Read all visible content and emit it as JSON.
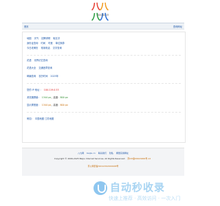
{
  "brand": {
    "mark": [
      "八",
      "八",
      "八",
      "八"
    ],
    "domain": "baijiu.cn"
  },
  "topbar": {
    "home": "首页",
    "setup": "查询网址"
  },
  "lines": {
    "l1": [
      "地图",
      "天气",
      "招聘求职",
      "取名字"
    ],
    "l2": [
      "身份证查询",
      "时间",
      "时差",
      "单位换算"
    ],
    "l3": [
      "今日老黄历",
      "常用电话",
      "汉字查询"
    ],
    "l4": [
      "花语",
      "世界记忆查询"
    ],
    "l5": [
      "花语大全",
      "交通违章查询"
    ],
    "l6": [
      "邮编查询",
      "农历时间",
      "2025年"
    ],
    "ip_label": "您的 IP 地址 ：",
    "ip_value": "100.119.0.53",
    "res_label": "浏览器屏幕：",
    "res_w": "1344 px",
    "res_sep": "，高度：",
    "res_h": "800 px",
    "view_label": "显示屏宽度：",
    "view_w": "1344 px",
    "view_sep": "，高度：",
    "view_h": "800 px",
    "loc_label": "例如：",
    "loc_value": "中国地图 江苏地图"
  },
  "footer": {
    "row1": [
      "八九网",
      "baijiu.cn",
      "联系我们",
      "隐私",
      "哪里实用网址"
    ],
    "copyright": "Copyright © 2006-2025 Baijiu Internet Services. All Rights Reserved.",
    "icp": "苏ICP备09024999号-12",
    "psb": "苏公网安备32012302000168号"
  },
  "watermark": {
    "title": "自动秒收录",
    "subtitle": "快速上推荐 · 高效访问 · 一次入门"
  }
}
